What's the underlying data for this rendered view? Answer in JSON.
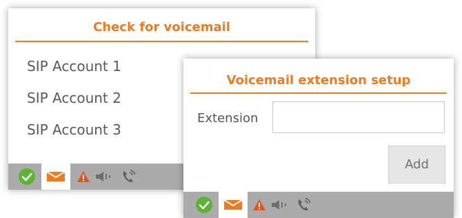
{
  "voicemail_panel": {
    "title": "Check for voicemail",
    "accounts": [
      "SIP Account 1",
      "SIP Account 2",
      "SIP Account 3"
    ]
  },
  "extension_panel": {
    "title": "Voicemail extension setup",
    "extension_label": "Extension",
    "extension_value": "",
    "add_label": "Add"
  },
  "statusbar": {
    "icons": [
      "status-ok-icon",
      "mail-icon",
      "warning-icon",
      "speaker-icon",
      "phone-icon"
    ]
  },
  "colors": {
    "accent": "#f07a1e",
    "status_ok": "#5cb532",
    "warning": "#e5541a",
    "statusbar_bg": "#ababab"
  }
}
